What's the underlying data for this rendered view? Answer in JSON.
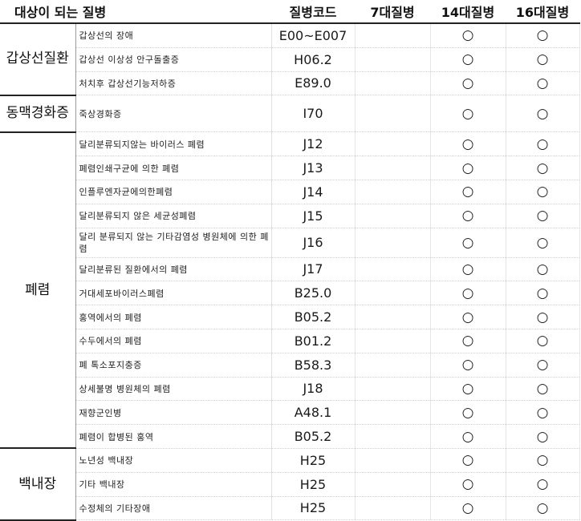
{
  "headers": {
    "disease": "대상이 되는 질병",
    "code": "질병코드",
    "c7": "7대질병",
    "c14": "14대질병",
    "c16": "16대질병"
  },
  "groups": {
    "thyroid": "갑상선질환",
    "arterio": "동맥경화증",
    "pneumonia": "폐렴",
    "cataract": "백내장"
  },
  "mark": "○",
  "rows": [
    {
      "name": "갑상선의 장애",
      "code": "E00~E007",
      "c7": "",
      "c14": "○",
      "c16": "○"
    },
    {
      "name": "갑상선 이상성 안구돌출증",
      "code": "H06.2",
      "c7": "",
      "c14": "○",
      "c16": "○"
    },
    {
      "name": "처치후 갑상선기능저하증",
      "code": "E89.0",
      "c7": "",
      "c14": "○",
      "c16": "○"
    },
    {
      "name": "죽상경화증",
      "code": "I70",
      "c7": "",
      "c14": "○",
      "c16": "○"
    },
    {
      "name": "달리분류되지않는 바이러스 폐렴",
      "code": "J12",
      "c7": "",
      "c14": "○",
      "c16": "○"
    },
    {
      "name": "폐렴인쇄구균에 의한 폐렴",
      "code": "J13",
      "c7": "",
      "c14": "○",
      "c16": "○"
    },
    {
      "name": "인플루엔자균에의한폐렴",
      "code": "J14",
      "c7": "",
      "c14": "○",
      "c16": "○"
    },
    {
      "name": "달리분류되지 않은 세균성폐렴",
      "code": "J15",
      "c7": "",
      "c14": "○",
      "c16": "○"
    },
    {
      "name": "달리 분류되지 않는 기타감염성 병원체에 의한 폐렴",
      "code": "J16",
      "c7": "",
      "c14": "○",
      "c16": "○"
    },
    {
      "name": "달리분류된 질환에서의 폐렴",
      "code": "J17",
      "c7": "",
      "c14": "○",
      "c16": "○"
    },
    {
      "name": "거대세포바이러스폐렴",
      "code": "B25.0",
      "c7": "",
      "c14": "○",
      "c16": "○"
    },
    {
      "name": "홍역에서의 폐렴",
      "code": "B05.2",
      "c7": "",
      "c14": "○",
      "c16": "○"
    },
    {
      "name": "수두에서의 폐렴",
      "code": "B01.2",
      "c7": "",
      "c14": "○",
      "c16": "○"
    },
    {
      "name": "폐 톡소포지충증",
      "code": "B58.3",
      "c7": "",
      "c14": "○",
      "c16": "○"
    },
    {
      "name": "상세불명 병원체의 폐렴",
      "code": "J18",
      "c7": "",
      "c14": "○",
      "c16": "○"
    },
    {
      "name": "재향군인병",
      "code": "A48.1",
      "c7": "",
      "c14": "○",
      "c16": "○"
    },
    {
      "name": "폐렴이 합병된 홍역",
      "code": "B05.2",
      "c7": "",
      "c14": "○",
      "c16": "○"
    },
    {
      "name": "노년성 백내장",
      "code": "H25",
      "c7": "",
      "c14": "○",
      "c16": "○"
    },
    {
      "name": "기타 백내장",
      "code": "H25",
      "c7": "",
      "c14": "○",
      "c16": "○"
    },
    {
      "name": "수정체의 기타장애",
      "code": "H25",
      "c7": "",
      "c14": "○",
      "c16": "○"
    }
  ]
}
